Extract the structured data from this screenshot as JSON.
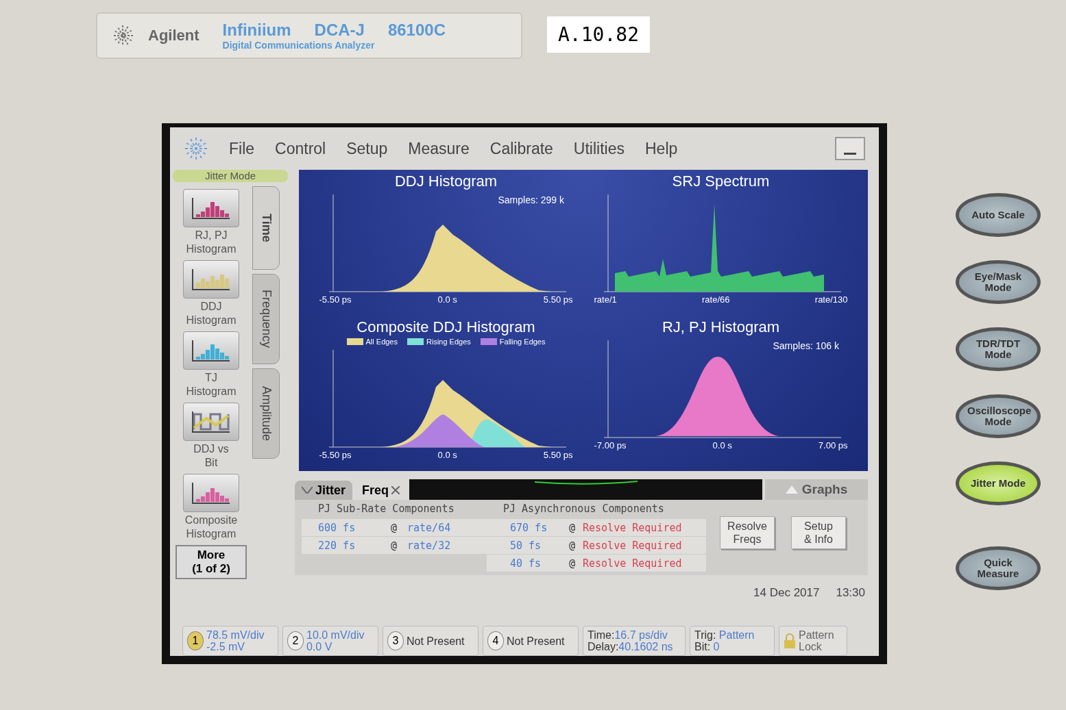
{
  "nameplate": {
    "brand": "Agilent",
    "product": "Infiniium",
    "model": "DCA-J",
    "number": "86100C",
    "subtitle": "Digital Communications Analyzer",
    "version_label": "A.10.82"
  },
  "menu": [
    "File",
    "Control",
    "Setup",
    "Measure",
    "Calibrate",
    "Utilities",
    "Help"
  ],
  "mode_label": "Jitter Mode",
  "side_buttons": [
    {
      "kind": "histogram",
      "color": "#c0407a",
      "lines": [
        "RJ, PJ",
        "Histogram"
      ]
    },
    {
      "kind": "bars",
      "color": "#d8c880",
      "lines": [
        "DDJ",
        "Histogram"
      ]
    },
    {
      "kind": "histogram",
      "color": "#40b0d8",
      "lines": [
        "TJ",
        "Histogram"
      ]
    },
    {
      "kind": "wave",
      "color": "#d8c850",
      "lines": [
        "DDJ vs",
        "Bit"
      ]
    },
    {
      "kind": "composite",
      "color": "#d860a0",
      "lines": [
        "Composite",
        "Histogram"
      ]
    }
  ],
  "more_button": [
    "More",
    "(1 of 2)"
  ],
  "side_tabs": [
    {
      "label": "Time",
      "selected": true
    },
    {
      "label": "Frequency",
      "selected": false
    },
    {
      "label": "Amplitude",
      "selected": false
    }
  ],
  "charts": [
    {
      "kind": "ddj",
      "title": "DDJ Histogram",
      "samples": "Samples: 299 k",
      "xticks": [
        "-5.50 ps",
        "0.0 s",
        "5.50 ps"
      ]
    },
    {
      "kind": "spectrum",
      "title": "SRJ Spectrum",
      "xticks": [
        "rate/1",
        "rate/66",
        "rate/130"
      ]
    },
    {
      "kind": "composite",
      "title": "Composite DDJ Histogram",
      "legend": [
        {
          "label": "All Edges",
          "color": "#e8d890"
        },
        {
          "label": "Rising Edges",
          "color": "#80e0d8"
        },
        {
          "label": "Falling Edges",
          "color": "#b080e0"
        }
      ],
      "xticks": [
        "-5.50 ps",
        "0.0 s",
        "5.50 ps"
      ]
    },
    {
      "kind": "gaussian",
      "title": "RJ, PJ Histogram",
      "samples": "Samples: 106 k",
      "xticks": [
        "-7.00 ps",
        "0.0 s",
        "7.00 ps"
      ]
    }
  ],
  "bottom_tabs": [
    {
      "label": "Jitter",
      "selected": false
    },
    {
      "label": "Freq",
      "selected": true
    }
  ],
  "graphs_button": "Graphs",
  "sub_rate": {
    "title": "PJ Sub-Rate Components",
    "rows": [
      {
        "amplitude": "600 fs",
        "at": "@",
        "rate": "rate/64"
      },
      {
        "amplitude": "220 fs",
        "at": "@",
        "rate": "rate/32"
      }
    ]
  },
  "asynchronous": {
    "title": "PJ Asynchronous Components",
    "rows": [
      {
        "amplitude": "670 fs",
        "at": "@",
        "status": "Resolve Required"
      },
      {
        "amplitude": "50 fs",
        "at": "@",
        "status": "Resolve Required"
      },
      {
        "amplitude": "40 fs",
        "at": "@",
        "status": "Resolve Required"
      }
    ]
  },
  "action_buttons": [
    [
      "Resolve",
      "Freqs"
    ],
    [
      "Setup",
      "& Info"
    ]
  ],
  "date": "14 Dec 2017",
  "time": "13:30",
  "channels": [
    {
      "number": "1",
      "active": true,
      "lines": [
        "78.5 mV/div",
        "-2.5 mV"
      ],
      "present": true
    },
    {
      "number": "2",
      "active": false,
      "lines": [
        "10.0 mV/div",
        "0.0 V"
      ],
      "present": true
    },
    {
      "number": "3",
      "active": false,
      "lines": [
        "Not Present"
      ],
      "present": false
    },
    {
      "number": "4",
      "active": false,
      "lines": [
        "Not Present"
      ],
      "present": false
    }
  ],
  "timebase": {
    "time_label": "Time:",
    "time": "16.7 ps/div",
    "delay_label": "Delay:",
    "delay": "40.1602 ns"
  },
  "trigger": {
    "trig_label": "Trig:",
    "trig": "Pattern",
    "bit_label": "Bit:",
    "bit": "0"
  },
  "pattern_lock": {
    "lines": [
      "Pattern",
      "Lock"
    ],
    "disabled": true
  },
  "front_buttons": [
    {
      "label": "Auto Scale",
      "lit": false
    },
    {
      "label": "Eye/Mask Mode",
      "lit": false
    },
    {
      "label": "TDR/TDT Mode",
      "lit": false
    },
    {
      "label": "Oscilloscope Mode",
      "lit": false
    },
    {
      "label": "Jitter Mode",
      "lit": true
    },
    {
      "label": "Quick Measure",
      "lit": false
    }
  ]
}
